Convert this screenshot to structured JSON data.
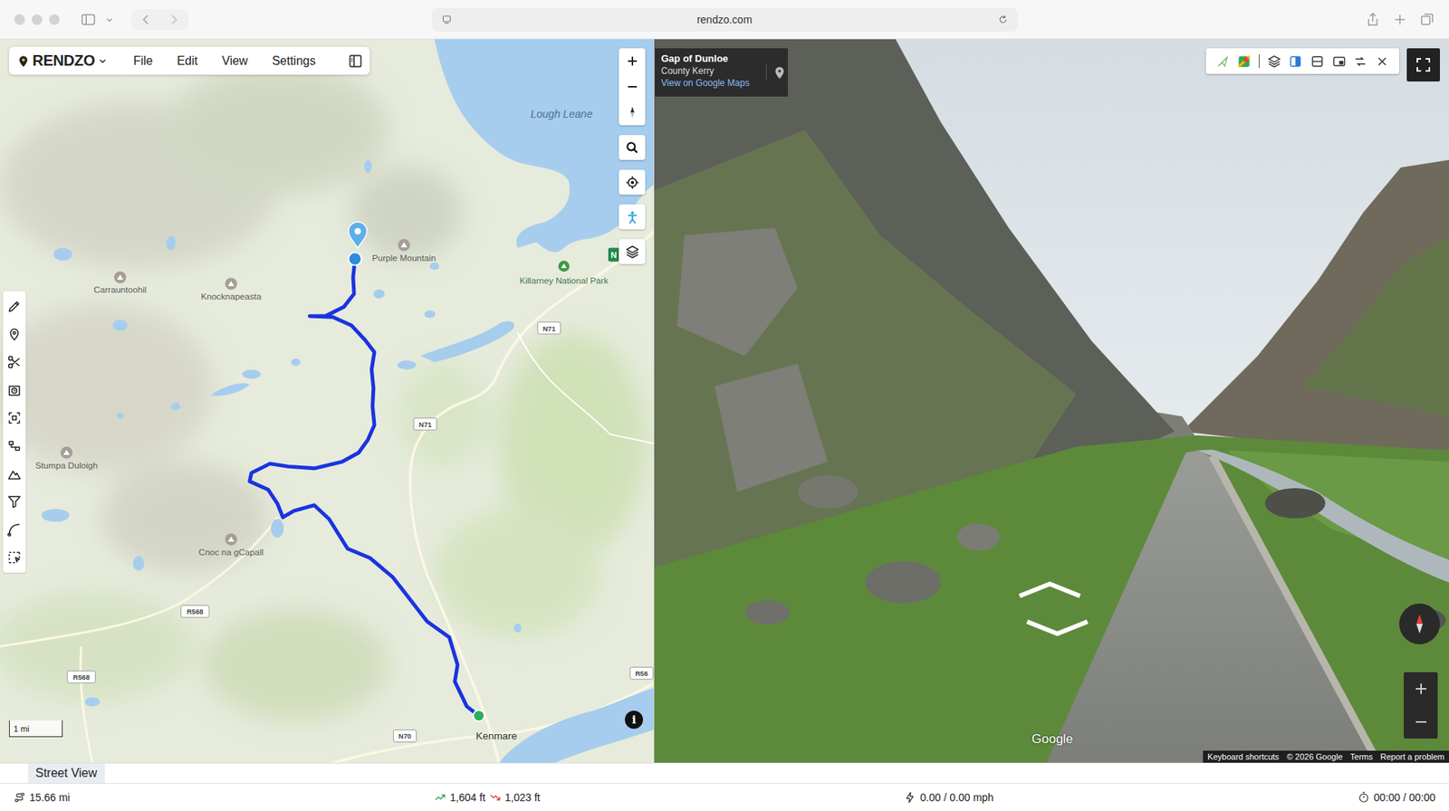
{
  "browser": {
    "url": "rendzo.com"
  },
  "app": {
    "logo": "RENDZO",
    "menu": [
      "File",
      "Edit",
      "View",
      "Settings"
    ]
  },
  "map": {
    "labels": [
      {
        "text": "Lough Leane",
        "kind": "water"
      },
      {
        "text": "Purple Mountain",
        "kind": "peak"
      },
      {
        "text": "Carrauntoohil",
        "kind": "peak"
      },
      {
        "text": "Knocknapeasta",
        "kind": "peak"
      },
      {
        "text": "Killarney National Park",
        "kind": "park"
      },
      {
        "text": "N71",
        "kind": "road"
      },
      {
        "text": "N71",
        "kind": "road"
      },
      {
        "text": "Stumpa Duloigh",
        "kind": "peak"
      },
      {
        "text": "Cnoc na gCapall",
        "kind": "peak"
      },
      {
        "text": "R568",
        "kind": "road"
      },
      {
        "text": "R568",
        "kind": "road"
      },
      {
        "text": "R56",
        "kind": "road"
      },
      {
        "text": "N70",
        "kind": "road"
      },
      {
        "text": "Kenmare",
        "kind": "town"
      },
      {
        "text": "N",
        "kind": "badge"
      }
    ],
    "scale": "1 mi",
    "info_glyph": "i"
  },
  "street_view": {
    "place": "Gap of Dunloe",
    "region": "County Kerry",
    "link": "View on Google Maps",
    "brand": "Google",
    "footer": [
      "Keyboard shortcuts",
      "© 2026 Google",
      "Terms",
      "Report a problem"
    ]
  },
  "bottom_tabs": [
    {
      "label": "Street View",
      "selected": true
    }
  ],
  "status_bar": {
    "distance": "15.66 mi",
    "ascent": "1,604 ft",
    "descent": "1,023 ft",
    "speed": "0.00 / 0.00 mph",
    "time": "00:00 / 00:00"
  }
}
